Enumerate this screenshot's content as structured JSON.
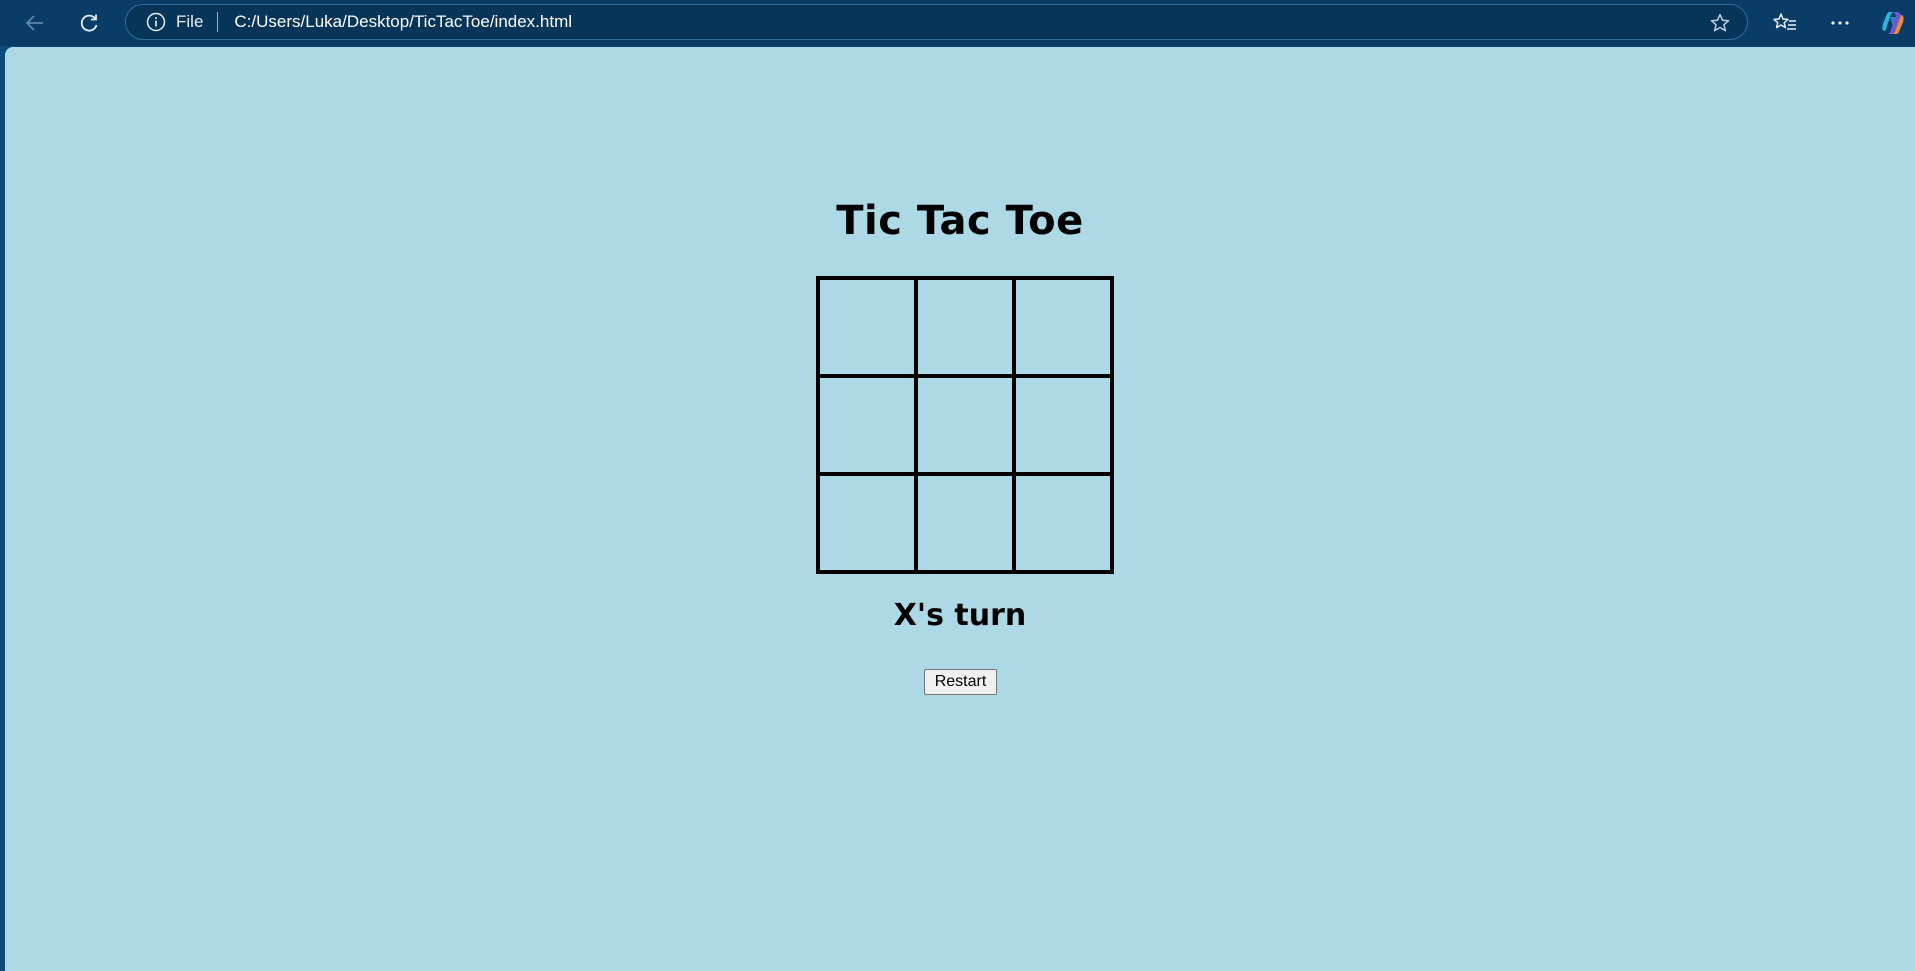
{
  "browser": {
    "scheme_label": "File",
    "url": "C:/Users/Luka/Desktop/TicTacToe/index.html",
    "icons": [
      "back-arrow-icon",
      "refresh-icon",
      "info-icon",
      "star-icon",
      "favorites-icon",
      "more-icon",
      "copilot-icon"
    ]
  },
  "game": {
    "title": "Tic Tac Toe",
    "cells": [
      "",
      "",
      "",
      "",
      "",
      "",
      "",
      "",
      ""
    ],
    "status": "X's turn",
    "restart_label": "Restart"
  },
  "colors": {
    "toolbar": "#093c66",
    "page_background": "#add8e6",
    "grid_lines": "#000000"
  }
}
